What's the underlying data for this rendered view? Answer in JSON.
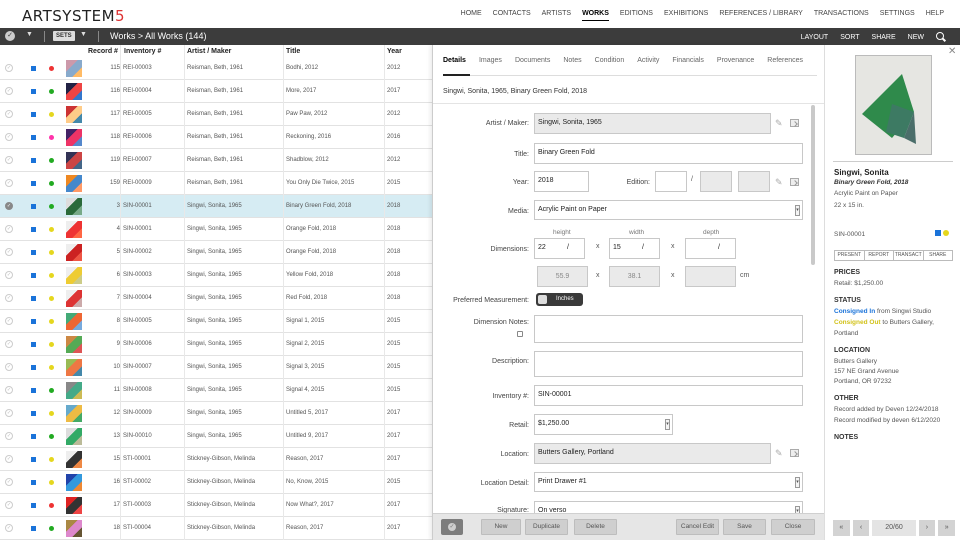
{
  "app": {
    "logo_main": "ARTSYSTEM",
    "logo_accent": "5"
  },
  "nav": {
    "items": [
      "HOME",
      "CONTACTS",
      "ARTISTS",
      "WORKS",
      "EDITIONS",
      "EXHIBITIONS",
      "REFERENCES / LIBRARY",
      "TRANSACTIONS",
      "SETTINGS",
      "HELP"
    ],
    "active": "WORKS"
  },
  "toolbar": {
    "sets_label": "SETS",
    "breadcrumb": "Works > All Works (144)",
    "right_items": [
      "LAYOUT",
      "SORT",
      "SHARE",
      "NEW"
    ]
  },
  "list": {
    "columns": [
      "Record #",
      "Inventory #",
      "Artist / Maker",
      "Title",
      "Year"
    ],
    "rows": [
      {
        "rec": "115",
        "inv": "REI-00003",
        "artist": "Reisman, Beth, 1961",
        "title": "Bodhi, 2012",
        "year": "2012",
        "dot": "#e33",
        "thumb": [
          "#c9a",
          "#8ac",
          "#fb6"
        ],
        "selected": false
      },
      {
        "rec": "116",
        "inv": "REI-00004",
        "artist": "Reisman, Beth, 1961",
        "title": "More, 2017",
        "year": "2017",
        "dot": "#2a2",
        "thumb": [
          "#224",
          "#e44",
          "#37c"
        ],
        "selected": false
      },
      {
        "rec": "117",
        "inv": "REI-00005",
        "artist": "Reisman, Beth, 1961",
        "title": "Paw Paw, 2012",
        "year": "2012",
        "dot": "#e5d71e",
        "thumb": [
          "#c33",
          "#fc8",
          "#48a"
        ],
        "selected": false
      },
      {
        "rec": "118",
        "inv": "REI-00006",
        "artist": "Reisman, Beth, 1961",
        "title": "Reckoning, 2016",
        "year": "2016",
        "dot": "#f3a",
        "thumb": [
          "#426",
          "#e36",
          "#58c"
        ],
        "selected": false
      },
      {
        "rec": "119",
        "inv": "REI-00007",
        "artist": "Reisman, Beth, 1961",
        "title": "Shadblow, 2012",
        "year": "2012",
        "dot": "#2a2",
        "thumb": [
          "#335",
          "#c44",
          "#468"
        ],
        "selected": false
      },
      {
        "rec": "159",
        "inv": "REI-00009",
        "artist": "Reisman, Beth, 1961",
        "title": "You Only Die Twice, 2015",
        "year": "2015",
        "dot": "#2a2",
        "thumb": [
          "#e82",
          "#48c",
          "#f96"
        ],
        "selected": false
      },
      {
        "rec": "3",
        "inv": "SIN-00001",
        "artist": "Singwi, Sonita, 1965",
        "title": "Binary Green Fold, 2018",
        "year": "2018",
        "dot": "#2a2",
        "thumb": [
          "#ddd",
          "#2a6a3a",
          "#7a8"
        ],
        "selected": true
      },
      {
        "rec": "4",
        "inv": "SIN-00001",
        "artist": "Singwi, Sonita, 1965",
        "title": "Orange Fold, 2018",
        "year": "2018",
        "dot": "#e5d71e",
        "thumb": [
          "#eee",
          "#e33",
          "#f64"
        ],
        "selected": false
      },
      {
        "rec": "5",
        "inv": "SIN-00002",
        "artist": "Singwi, Sonita, 1965",
        "title": "Orange Fold, 2018",
        "year": "2018",
        "dot": "#e5d71e",
        "thumb": [
          "#eee",
          "#c22",
          "#e54"
        ],
        "selected": false
      },
      {
        "rec": "6",
        "inv": "SIN-00003",
        "artist": "Singwi, Sonita, 1965",
        "title": "Yellow Fold, 2018",
        "year": "2018",
        "dot": "#e5d71e",
        "thumb": [
          "#eee",
          "#ec3",
          "#cc8"
        ],
        "selected": false
      },
      {
        "rec": "7",
        "inv": "SIN-00004",
        "artist": "Singwi, Sonita, 1965",
        "title": "Red Fold, 2018",
        "year": "2018",
        "dot": "#e5d71e",
        "thumb": [
          "#eee",
          "#d33",
          "#caa"
        ],
        "selected": false
      },
      {
        "rec": "8",
        "inv": "SIN-00005",
        "artist": "Singwi, Sonita, 1965",
        "title": "Signal 1, 2015",
        "year": "2015",
        "dot": "#e5d71e",
        "thumb": [
          "#4a7",
          "#e63",
          "#7ad"
        ],
        "selected": false
      },
      {
        "rec": "9",
        "inv": "SIN-00006",
        "artist": "Singwi, Sonita, 1965",
        "title": "Signal 2, 2015",
        "year": "2015",
        "dot": "#e5d71e",
        "thumb": [
          "#c84",
          "#5a5",
          "#d55"
        ],
        "selected": false
      },
      {
        "rec": "10",
        "inv": "SIN-00007",
        "artist": "Singwi, Sonita, 1965",
        "title": "Signal 3, 2015",
        "year": "2015",
        "dot": "#e5d71e",
        "thumb": [
          "#9b5",
          "#e74",
          "#48a"
        ],
        "selected": false
      },
      {
        "rec": "11",
        "inv": "SIN-00008",
        "artist": "Singwi, Sonita, 1965",
        "title": "Signal 4, 2015",
        "year": "2015",
        "dot": "#2a2",
        "thumb": [
          "#888",
          "#4a8",
          "#cb5"
        ],
        "selected": false
      },
      {
        "rec": "12",
        "inv": "SIN-00009",
        "artist": "Singwi, Sonita, 1965",
        "title": "Untitled 5, 2017",
        "year": "2017",
        "dot": "#e5d71e",
        "thumb": [
          "#6ac",
          "#eb4",
          "#4a6"
        ],
        "selected": false
      },
      {
        "rec": "13",
        "inv": "SIN-00010",
        "artist": "Singwi, Sonita, 1965",
        "title": "Untitled 9, 2017",
        "year": "2017",
        "dot": "#2a2",
        "thumb": [
          "#ddd",
          "#3a6",
          "#bb9"
        ],
        "selected": false
      },
      {
        "rec": "15",
        "inv": "STI-00001",
        "artist": "Stickney-Gibson, Melinda",
        "title": "Reason, 2017",
        "year": "2017",
        "dot": "#e5d71e",
        "thumb": [
          "#eee",
          "#333",
          "#e84"
        ],
        "selected": false
      },
      {
        "rec": "16",
        "inv": "STI-00002",
        "artist": "Stickney-Gibson, Melinda",
        "title": "No, Know, 2015",
        "year": "2015",
        "dot": "#e5d71e",
        "thumb": [
          "#24a",
          "#39d",
          "#e83"
        ],
        "selected": false
      },
      {
        "rec": "17",
        "inv": "STI-00003",
        "artist": "Stickney-Gibson, Melinda",
        "title": "Now What?, 2017",
        "year": "2017",
        "dot": "#e33",
        "thumb": [
          "#d22",
          "#333",
          "#e44"
        ],
        "selected": false
      },
      {
        "rec": "18",
        "inv": "STI-00004",
        "artist": "Stickney-Gibson, Melinda",
        "title": "Reason, 2017",
        "year": "2017",
        "dot": "#2a2",
        "thumb": [
          "#a84",
          "#d8c",
          "#653"
        ],
        "selected": false
      }
    ]
  },
  "detail": {
    "tabs": [
      "Details",
      "Images",
      "Documents",
      "Notes",
      "Condition",
      "Activity",
      "Financials",
      "Provenance",
      "References"
    ],
    "active_tab": "Details",
    "subtitle": "Singwi, Sonita, 1965, Binary Green Fold, 2018",
    "labels": {
      "artist": "Artist / Maker:",
      "title": "Title:",
      "year": "Year:",
      "edition": "Edition:",
      "media": "Media:",
      "dimensions": "Dimensions:",
      "preferred": "Preferred Measurement:",
      "dim_notes": "Dimension Notes:",
      "description": "Description:",
      "inventory": "Inventory #:",
      "retail": "Retail:",
      "location": "Location:",
      "location_detail": "Location Detail:",
      "signature": "Signature:"
    },
    "values": {
      "artist": "Singwi, Sonita, 1965",
      "title": "Binary Green Fold",
      "year": "2018",
      "edition_num": "",
      "edition_of": "",
      "media": "Acrylic Paint on Paper",
      "height": "22",
      "width": "15",
      "depth": "",
      "height_cm": "55.9",
      "width_cm": "38.1",
      "depth_cm": "",
      "preferred": "Inches",
      "dim_notes": "",
      "description": "",
      "inventory": "SIN-00001",
      "retail": "$1,250.00",
      "location": "Butters Gallery, Portland",
      "location_detail": "Print Drawer #1",
      "signature": "On verso"
    },
    "dim_headers": {
      "height": "height",
      "width": "width",
      "depth": "depth",
      "frac": "/",
      "times": "x",
      "cm": "cm"
    },
    "actions": [
      "New",
      "Duplicate",
      "Delete",
      "Cancel Edit",
      "Save",
      "Close"
    ]
  },
  "preview": {
    "close": "✕",
    "artist": "Singwi, Sonita",
    "title": "Binary Green Fold, 2018",
    "media": "Acrylic Paint on Paper",
    "size": "22 x 15 in.",
    "inventory": "SIN-00001",
    "buttons": [
      "PRESENT",
      "REPORT",
      "TRANSACT",
      "SHARE"
    ],
    "prices_head": "PRICES",
    "retail": "Retail: $1,250.00",
    "status_head": "STATUS",
    "status1_label": "Consigned In",
    "status1_text": "from Singwi Studio",
    "status2_label": "Consigned Out",
    "status2_text": "to Butters Gallery,",
    "status2_text2": "Portland",
    "location_head": "LOCATION",
    "location_lines": [
      "Butters Gallery",
      "157 NE Grand Avenue",
      "Portland, OR 97232"
    ],
    "other_head": "OTHER",
    "other_lines": [
      "Record added by Deven 12/24/2018",
      "Record modified by deven 6/12/2020"
    ],
    "notes_head": "NOTES",
    "pager": {
      "first": "«",
      "prev": "‹",
      "page": "20/60",
      "next": "›",
      "last": "»"
    }
  },
  "colors": {
    "status_in": "#1a73d9",
    "status_out": "#d2c21a",
    "selected_row": "#d6ecf3",
    "toolbar": "#3c3c3c"
  }
}
